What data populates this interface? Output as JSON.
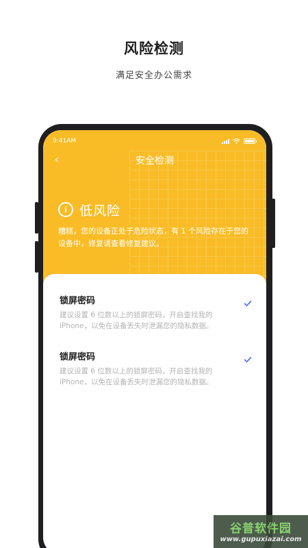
{
  "promo": {
    "title": "风险检测",
    "subtitle": "满足安全办公需求"
  },
  "status_bar": {
    "time": "9:41AM",
    "icons": [
      "signal-icon",
      "wifi-icon",
      "battery-icon"
    ]
  },
  "nav": {
    "back_icon": "chevron-left-icon",
    "title": "安全检测"
  },
  "risk": {
    "icon": "info-icon",
    "icon_glyph": "i",
    "level": "低风险",
    "description": "糟糕，您的设备正处于危险状态，有 1 个风险存在于您的设备中，修复请查看修复建议。"
  },
  "items": [
    {
      "title": "锁屏密码",
      "description": "建议设置 6 位数以上的锁屏密码，开启查找我的 iPhone，以免在设备丢失时泄漏您的隐私数据。",
      "checked": true
    },
    {
      "title": "锁屏密码",
      "description": "建议设置 6 位数以上的锁屏密码，开启查找我的 iPhone，以免在设备丢失时泄漏您的隐私数据。",
      "checked": true
    }
  ],
  "watermark": {
    "name": "谷普软件园",
    "url": "www.gupuxiazai.com"
  },
  "colors": {
    "accent_yellow": "#f9bc26",
    "check_blue": "#3f6df2",
    "phone_frame": "#1f1f22"
  }
}
